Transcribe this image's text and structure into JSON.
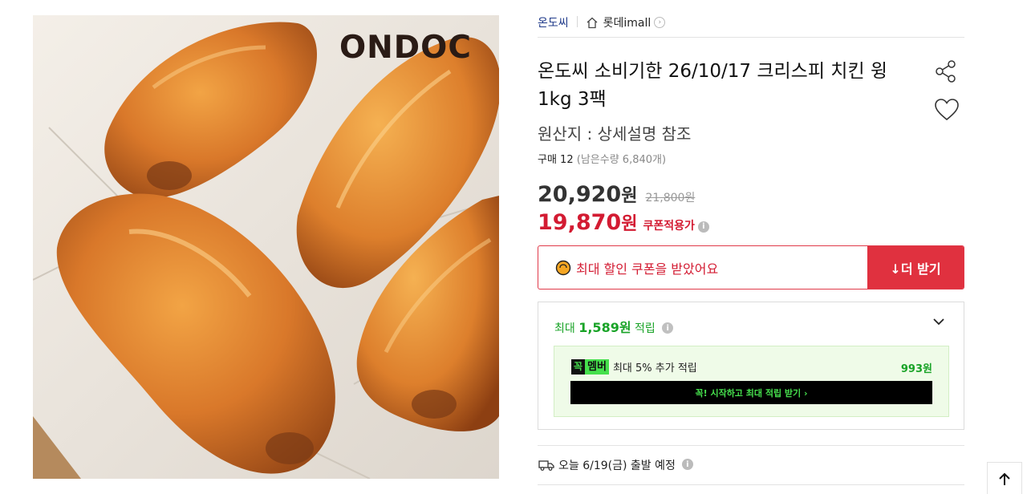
{
  "image": {
    "alt_logo": "ONDOC",
    "logo_text": "ONDOC"
  },
  "brand": {
    "name": "온도씨",
    "store": "롯데imall",
    "store_chevron": "›"
  },
  "product": {
    "title": "온도씨 소비기한 26/10/17 크리스피 치킨 윙 1kg 3팩",
    "origin": "원산지 : 상세설명 참조",
    "purchase_count": "구매 12",
    "remaining": "(남은수량 6,840개)"
  },
  "price": {
    "sale_value": "20,920",
    "sale_unit": "원",
    "original": "21,800원",
    "coupon_value": "19,870",
    "coupon_unit": "원",
    "coupon_note": "쿠폰적용가",
    "info_glyph": "i"
  },
  "coupon": {
    "message": "최대 할인 쿠폰을 받았어요",
    "more_button": "↓더 받기"
  },
  "reward": {
    "prefix": "최대",
    "amount": "1,589원",
    "suffix": "적립",
    "member_mark": "꼭",
    "member_word": "멤버",
    "member_text": "최대 5% 추가 적립",
    "member_amount": "993원",
    "member_cta": "꼭! 시작하고 최대 적립 받기 ›"
  },
  "shipping": {
    "text": "오늘 6/19(금) 출발 예정"
  },
  "colors": {
    "accent_red": "#e0313f",
    "price_red": "#d31b32",
    "reward_green": "#19a327",
    "member_green": "#46e04d",
    "brand_blue": "#1f3a8a"
  },
  "icons": [
    "home-icon",
    "chevron-right-icon",
    "share-icon",
    "heart-icon",
    "coin-icon",
    "info-icon",
    "chevron-down-icon",
    "truck-icon",
    "arrow-up-icon"
  ]
}
